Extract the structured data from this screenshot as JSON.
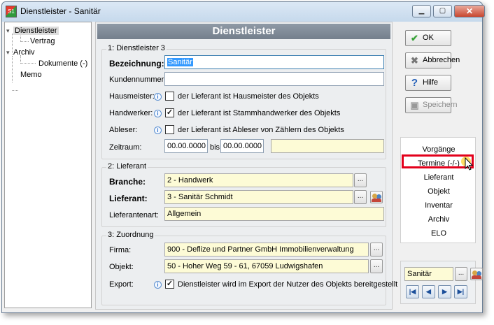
{
  "window": {
    "title": "Dienstleister - Sanitär",
    "app_icon": "app-logo-icon"
  },
  "tree": {
    "items": [
      {
        "label": "Dienstleister",
        "level": 0,
        "expanded": true,
        "selected": true
      },
      {
        "label": "Vertrag",
        "level": 1
      },
      {
        "label": "Archiv",
        "level": 0,
        "expanded": true
      },
      {
        "label": "Dokumente (-)",
        "level": 2
      },
      {
        "label": "Memo",
        "level": 0
      }
    ]
  },
  "main": {
    "header": "Dienstleister",
    "group1": {
      "title": "1: Dienstleister 3",
      "bezeichnung_label": "Bezeichnung:",
      "bezeichnung_value": "Sanitär",
      "kundennummer_label": "Kundennummer:",
      "kundennummer_value": "",
      "hausmeister_label": "Hausmeister:",
      "hausmeister_text": "der Lieferant ist Hausmeister des Objekts",
      "hausmeister_checked": false,
      "handwerker_label": "Handwerker:",
      "handwerker_text": "der Lieferant ist Stammhandwerker des Objekts",
      "handwerker_checked": true,
      "ableser_label": "Ableser:",
      "ableser_text": "der Lieferant ist Ableser von Zählern des Objekts",
      "ableser_checked": false,
      "zeitraum_label": "Zeitraum:",
      "zeitraum_from": "00.00.0000",
      "zeitraum_bis": "bis",
      "zeitraum_to": "00.00.0000",
      "zeitraum_note": ""
    },
    "group2": {
      "title": "2: Lieferant",
      "branche_label": "Branche:",
      "branche_value": "2 - Handwerk",
      "lieferant_label": "Lieferant:",
      "lieferant_value": "3 - Sanitär Schmidt",
      "lieferantenart_label": "Lieferantenart:",
      "lieferantenart_value": "Allgemein"
    },
    "group3": {
      "title": "3: Zuordnung",
      "firma_label": "Firma:",
      "firma_value": "900 - Deflize und Partner GmbH Immobilienverwaltung",
      "objekt_label": "Objekt:",
      "objekt_value": "50 - Hoher Weg 59 - 61, 67059 Ludwigshafen",
      "export_label": "Export:",
      "export_text": "Dienstleister wird im Export der Nutzer des Objekts bereitgestellt",
      "export_checked": true
    },
    "dots": "...",
    "check_mark": "✓",
    "info_glyph": "i"
  },
  "actions": {
    "ok": "OK",
    "abbrechen": "Abbrechen",
    "hilfe": "Hilfe",
    "speichern": "Speichern",
    "speichern_enabled": false
  },
  "nav_links": [
    "Vorgänge",
    "Termine (-/-)",
    "Lieferant",
    "Objekt",
    "Inventar",
    "Archiv",
    "ELO"
  ],
  "nav_highlighted": "Termine (-/-)",
  "bottom": {
    "filter_value": "Sanitär",
    "arrows": [
      "first",
      "previous",
      "next",
      "last"
    ]
  },
  "colors": {
    "header_bg": "#8a95a1",
    "required_field_bg": "#fdfbd6",
    "highlight_border": "#e3001b",
    "selection": "#3399ff"
  }
}
